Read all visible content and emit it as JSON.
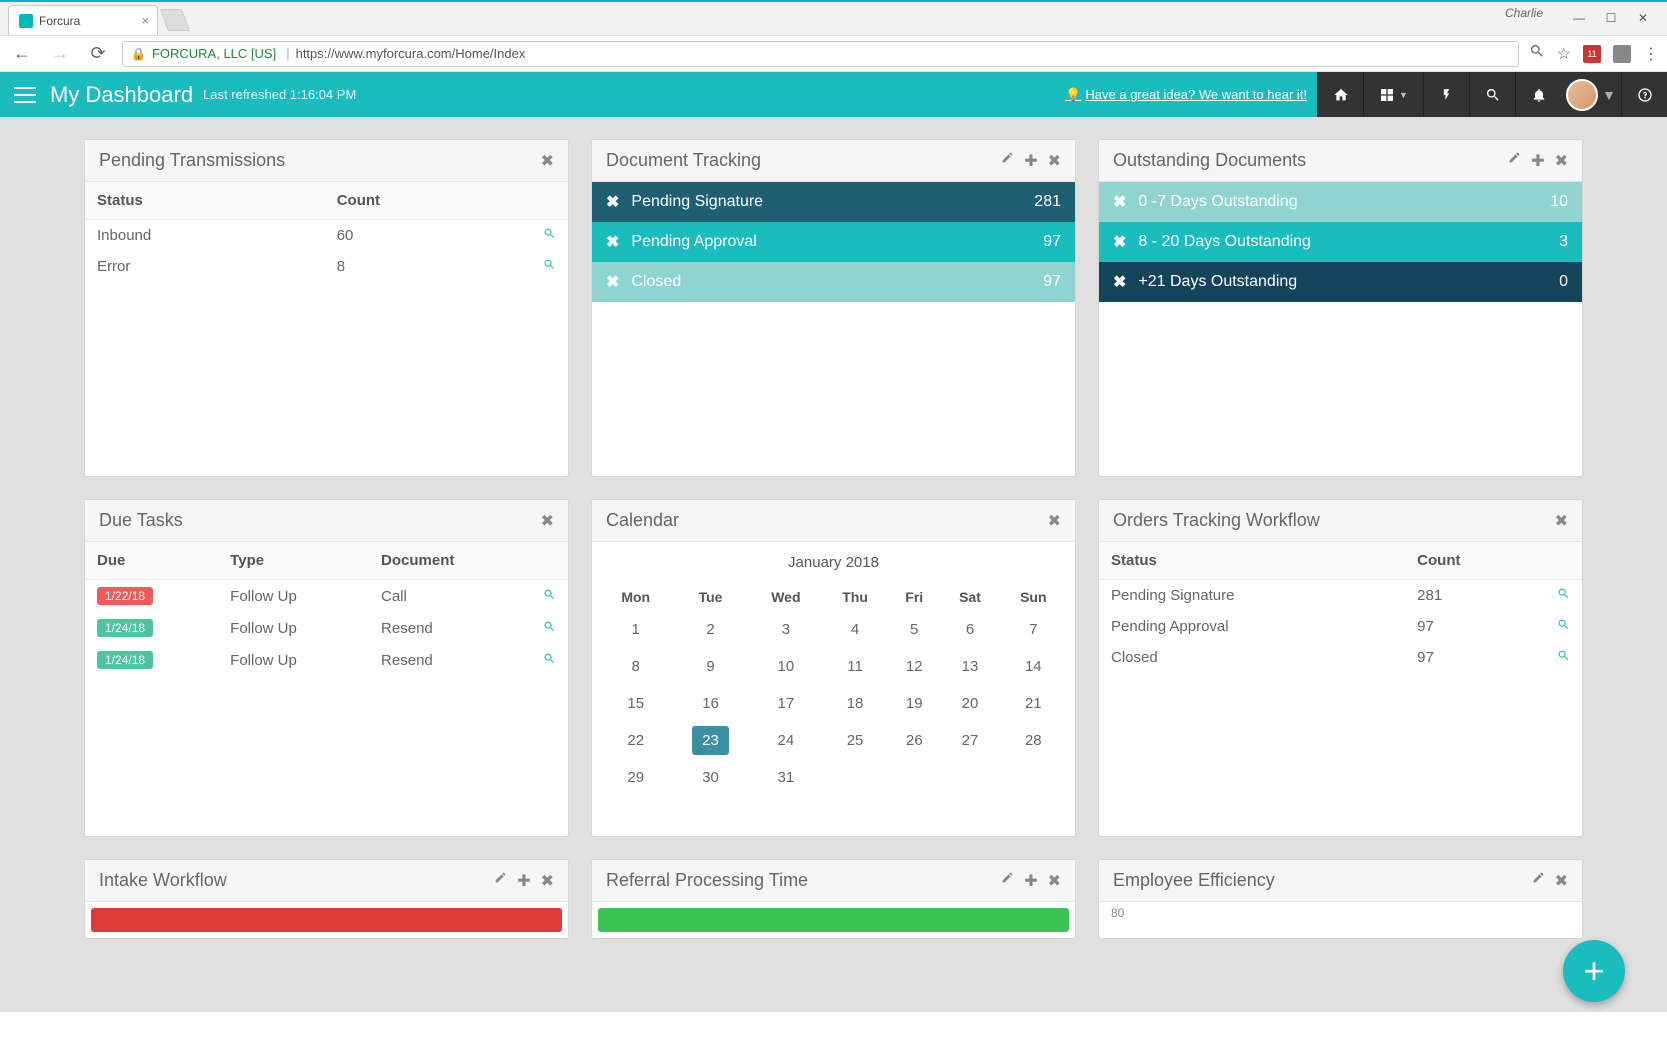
{
  "browser": {
    "user": "Charlie",
    "tab_title": "Forcura",
    "org": "FORCURA, LLC [US]",
    "url": "https://www.myforcura.com/Home/Index",
    "ext_badge": "11"
  },
  "header": {
    "title": "My Dashboard",
    "refreshed": "Last refreshed 1:16:04 PM",
    "idea_link": "Have a great idea? We want to hear it!"
  },
  "widgets": {
    "pending_trans": {
      "title": "Pending Transmissions",
      "cols": {
        "status": "Status",
        "count": "Count"
      },
      "rows": [
        {
          "status": "Inbound",
          "count": "60"
        },
        {
          "status": "Error",
          "count": "8"
        }
      ]
    },
    "doc_track": {
      "title": "Document Tracking",
      "rows": [
        {
          "label": "Pending Signature",
          "count": "281",
          "cls": "dark"
        },
        {
          "label": "Pending Approval",
          "count": "97",
          "cls": "teal"
        },
        {
          "label": "Closed",
          "count": "97",
          "cls": "light"
        }
      ]
    },
    "outstanding": {
      "title": "Outstanding Documents",
      "rows": [
        {
          "label": "0 -7 Days Outstanding",
          "count": "10",
          "cls": "light"
        },
        {
          "label": "8 - 20 Days Outstanding",
          "count": "3",
          "cls": "teal"
        },
        {
          "label": "+21 Days Outstanding",
          "count": "0",
          "cls": "darker"
        }
      ]
    },
    "due_tasks": {
      "title": "Due Tasks",
      "cols": {
        "due": "Due",
        "type": "Type",
        "doc": "Document"
      },
      "rows": [
        {
          "due": "1/22/18",
          "badge": "red",
          "type": "Follow Up",
          "doc": "Call"
        },
        {
          "due": "1/24/18",
          "badge": "grn",
          "type": "Follow Up",
          "doc": "Resend"
        },
        {
          "due": "1/24/18",
          "badge": "grn",
          "type": "Follow Up",
          "doc": "Resend"
        }
      ]
    },
    "calendar": {
      "title": "Calendar",
      "month": "January 2018",
      "dow": [
        "Mon",
        "Tue",
        "Wed",
        "Thu",
        "Fri",
        "Sat",
        "Sun"
      ],
      "weeks": [
        [
          "1",
          "2",
          "3",
          "4",
          "5",
          "6",
          "7"
        ],
        [
          "8",
          "9",
          "10",
          "11",
          "12",
          "13",
          "14"
        ],
        [
          "15",
          "16",
          "17",
          "18",
          "19",
          "20",
          "21"
        ],
        [
          "22",
          "23",
          "24",
          "25",
          "26",
          "27",
          "28"
        ],
        [
          "29",
          "30",
          "31",
          "",
          "",
          "",
          ""
        ]
      ],
      "today": "23"
    },
    "orders": {
      "title": "Orders Tracking Workflow",
      "cols": {
        "status": "Status",
        "count": "Count"
      },
      "rows": [
        {
          "status": "Pending Signature",
          "count": "281"
        },
        {
          "status": "Pending Approval",
          "count": "97"
        },
        {
          "status": "Closed",
          "count": "97"
        }
      ]
    },
    "bottom": {
      "intake": "Intake Workflow",
      "referral": "Referral Processing Time",
      "employee": "Employee Efficiency",
      "employee_val": "80"
    }
  }
}
